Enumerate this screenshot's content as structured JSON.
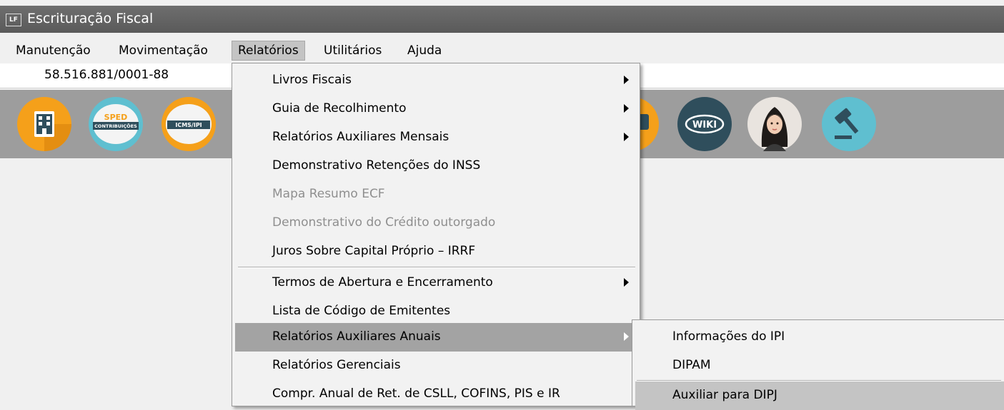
{
  "window": {
    "title": "Escrituração Fiscal",
    "app_icon_text": "LF"
  },
  "menubar": {
    "items": [
      "Manutenção",
      "Movimentação",
      "Relatórios",
      "Utilitários",
      "Ajuda"
    ]
  },
  "company": {
    "cnpj": "58.516.881/0001-88"
  },
  "toolbar": {
    "icons": [
      {
        "name": "building-icon",
        "label": ""
      },
      {
        "name": "sped-contribuicoes-icon",
        "label_top": "SPED",
        "label_bottom": "CONTRIBUIÇÕES"
      },
      {
        "name": "icms-ipi-icon",
        "label": "ICMS/IPI"
      },
      {
        "name": "chat-icon",
        "label": ""
      },
      {
        "name": "wiki-icon",
        "label": "WIKI"
      },
      {
        "name": "assistant-avatar-icon",
        "label": ""
      },
      {
        "name": "gavel-icon",
        "label": ""
      }
    ]
  },
  "relatorios_menu": {
    "items": [
      {
        "label": "Livros Fiscais",
        "submenu": true,
        "enabled": true
      },
      {
        "label": "Guia de Recolhimento",
        "submenu": true,
        "enabled": true
      },
      {
        "label": "Relatórios Auxiliares Mensais",
        "submenu": true,
        "enabled": true
      },
      {
        "label": "Demonstrativo Retenções do INSS",
        "submenu": false,
        "enabled": true
      },
      {
        "label": "Mapa Resumo ECF",
        "submenu": false,
        "enabled": false
      },
      {
        "label": "Demonstrativo do Crédito outorgado",
        "submenu": false,
        "enabled": false
      },
      {
        "label": "Juros Sobre Capital Próprio – IRRF",
        "submenu": false,
        "enabled": true
      },
      {
        "label": "Termos de Abertura e Encerramento",
        "submenu": true,
        "enabled": true
      },
      {
        "label": "Lista de Código de Emitentes",
        "submenu": false,
        "enabled": true
      },
      {
        "label": "Relatórios Auxiliares Anuais",
        "submenu": true,
        "enabled": true,
        "highlighted": true
      },
      {
        "label": "Relatórios Gerenciais",
        "submenu": false,
        "enabled": true
      },
      {
        "label": "Compr. Anual de Ret. de CSLL, COFINS,  PIS e IR",
        "submenu": false,
        "enabled": true
      }
    ]
  },
  "anuais_submenu": {
    "items": [
      {
        "label": "Informações do IPI"
      },
      {
        "label": "DIPAM"
      },
      {
        "label": "Auxiliar para DIPJ",
        "highlighted": true
      }
    ]
  },
  "colors": {
    "titlebar": "#5f5f5f",
    "toolbar": "#9d9d9d",
    "menu_highlight": "#a3a3a3",
    "disabled_text": "#8f8f8f",
    "orange": "#f5a01a",
    "teal": "#2f4e5c",
    "light_blue": "#5fbfd0"
  }
}
